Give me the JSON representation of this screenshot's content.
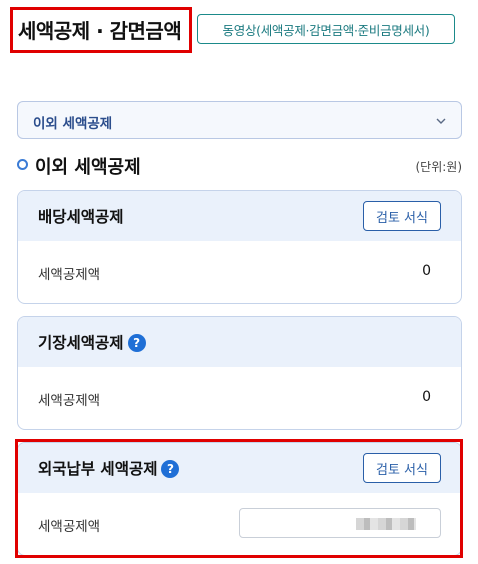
{
  "header": {
    "title": "세액공제 · 감면금액",
    "attachment_button": "동영상(세액공제·감면금액·준비금명세서)"
  },
  "dropdown": {
    "selected": "이외 세액공제"
  },
  "section": {
    "title": "이외 세액공제",
    "unit": "(단위:원)"
  },
  "cards": [
    {
      "title": "배당세액공제",
      "has_help": false,
      "review_label": "검토 서식",
      "row_label": "세액공제액",
      "value": "0"
    },
    {
      "title": "기장세액공제",
      "has_help": true,
      "help_symbol": "?",
      "row_label": "세액공제액",
      "value": "0"
    },
    {
      "title": "외국납부 세액공제",
      "has_help": true,
      "help_symbol": "?",
      "review_label": "검토 서식",
      "row_label": "세액공제액",
      "value": ""
    }
  ],
  "colors": {
    "highlight": "#e00000",
    "accent": "#1f6fd6",
    "card_header_bg": "#eaf1fb"
  }
}
